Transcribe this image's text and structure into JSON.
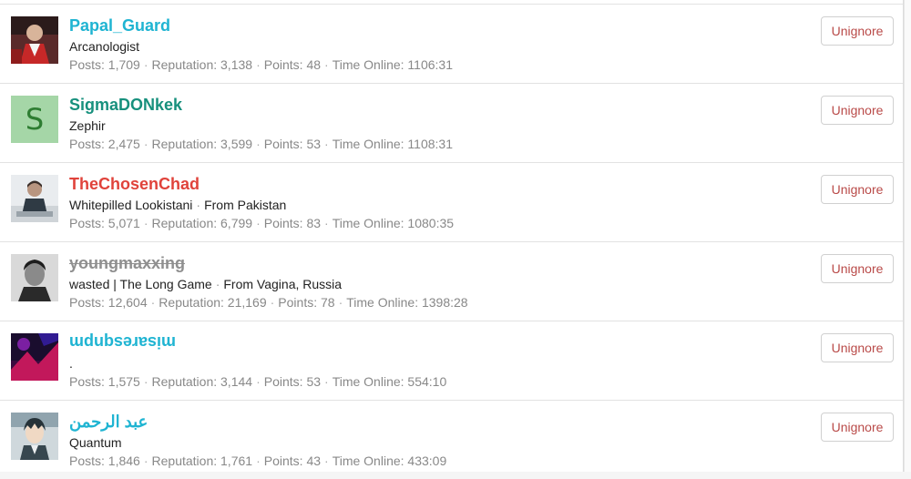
{
  "button_label": "Unignore",
  "separator": "·",
  "stat_labels": {
    "posts": "Posts:",
    "reputation": "Reputation:",
    "points": "Points:",
    "time": "Time Online:"
  },
  "users": [
    {
      "name": "Papal_Guard",
      "name_color": "#1fb4d2",
      "title": "Arcanologist",
      "location": "",
      "posts": "1,709",
      "reputation": "3,138",
      "points": "48",
      "time_online": "1106:31"
    },
    {
      "name": "SigmaDONkek",
      "name_color": "#17907d",
      "avatar_letter": "S",
      "title": "Zephir",
      "location": "",
      "posts": "2,475",
      "reputation": "3,599",
      "points": "53",
      "time_online": "1108:31"
    },
    {
      "name": "TheChosenChad",
      "name_color": "#e0433b",
      "title": "Whitepilled Lookistani",
      "location": "From Pakistan",
      "posts": "5,071",
      "reputation": "6,799",
      "points": "83",
      "time_online": "1080:35"
    },
    {
      "name": "youngmaxxing",
      "name_color": "#8f8f8f",
      "title": "wasted | The Long Game",
      "location": "From Vagina, Russia",
      "posts": "12,604",
      "reputation": "21,169",
      "points": "78",
      "time_online": "1398:28"
    },
    {
      "name": "misaresqnpm",
      "name_color": "#1fb4d2",
      "title": ".",
      "location": "",
      "posts": "1,575",
      "reputation": "3,144",
      "points": "53",
      "time_online": "554:10"
    },
    {
      "name": "عبد الرحمن",
      "name_color": "#1fb4d2",
      "title": "Quantum",
      "location": "",
      "posts": "1,846",
      "reputation": "1,761",
      "points": "43",
      "time_online": "433:09"
    }
  ]
}
